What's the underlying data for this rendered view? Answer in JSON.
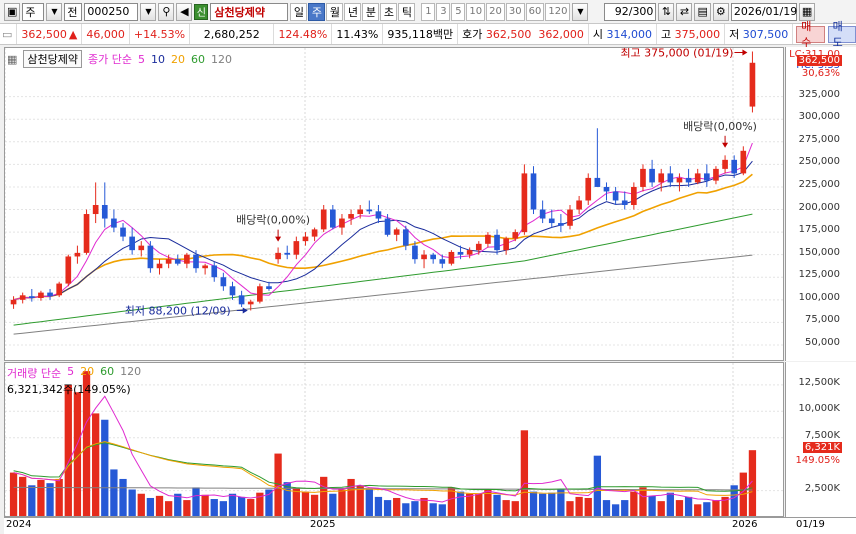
{
  "toolbar": {
    "market": "주",
    "type": "전",
    "code": "000250",
    "stock_name": "삼천당제약",
    "credit_badge": "신",
    "periods": [
      "일",
      "주",
      "월",
      "년",
      "분",
      "초",
      "틱"
    ],
    "active_period": "주",
    "ticks": [
      "1",
      "3",
      "5",
      "10",
      "20",
      "30",
      "60",
      "120"
    ],
    "count": "92/300",
    "date": "2026/01/19"
  },
  "quote": {
    "price": "362,500",
    "up_arrow": "▲",
    "change": "46,000",
    "change_pct": "+14.53%",
    "volume": "2,680,252",
    "vol_ratio": "124.48%",
    "turnover": "11.43%",
    "amount": "935,118백만",
    "ask_label": "호가",
    "ask1": "362,500",
    "ask2": "362,000",
    "open_label": "시",
    "open": "314,000",
    "high_label": "고",
    "high": "375,000",
    "low_label": "저",
    "low": "307,500",
    "buy_label": "매수",
    "sell_label": "매도"
  },
  "price_panel": {
    "tab": "삼천당제약",
    "ma_title": "종가 단순",
    "ma_periods": [
      "5",
      "10",
      "20",
      "60",
      "120"
    ],
    "annotations": {
      "high": "최고 375,000 (01/19)",
      "low": "최저 88,200 (12/09)",
      "dividend1": "배당락(0,00%)",
      "dividend2": "배당락(0,00%)"
    },
    "axis_top": "LC:311.00",
    "axis_top2": "HC:-3.33",
    "current_tag": "362,500",
    "current_pct": "30,63%",
    "y_ticks": [
      "325,000",
      "300,000",
      "275,000",
      "250,000",
      "225,000",
      "200,000",
      "175,000",
      "150,000",
      "125,000",
      "100,000",
      "75,000",
      "50,000"
    ]
  },
  "volume_panel": {
    "title": "거래량 단순",
    "ma_periods": [
      "5",
      "20",
      "60",
      "120"
    ],
    "current": "6,321,342주(149.05%)",
    "current_tag": "6,321K",
    "current_pct": "149.05%",
    "y_ticks": [
      "12,500K",
      "10,000K",
      "7,500K",
      "2,500K"
    ]
  },
  "date_axis": {
    "labels": [
      "2024",
      "2025",
      "2026"
    ],
    "cursor_date": "01/19"
  },
  "colors": {
    "up": "#e52b1c",
    "down": "#2659d6",
    "ma5": "#e02ad0",
    "ma10": "#1a2c9c",
    "ma20": "#f0a100",
    "ma60": "#2e9b2e",
    "ma120": "#808080"
  },
  "chart_data": {
    "type": "candlestick",
    "price_range": [
      40000,
      370000
    ],
    "candles": [
      [
        95000,
        104000,
        90000,
        100000
      ],
      [
        100000,
        108000,
        96000,
        105000
      ],
      [
        104000,
        112000,
        98000,
        102000
      ],
      [
        102000,
        110000,
        99000,
        108000
      ],
      [
        108000,
        112000,
        100000,
        104000
      ],
      [
        105000,
        120000,
        103000,
        118000
      ],
      [
        118000,
        150000,
        115000,
        148000
      ],
      [
        148000,
        160000,
        140000,
        152000
      ],
      [
        152000,
        200000,
        150000,
        195000
      ],
      [
        195000,
        230000,
        185000,
        205000
      ],
      [
        205000,
        230000,
        180000,
        190000
      ],
      [
        190000,
        200000,
        175000,
        180000
      ],
      [
        180000,
        185000,
        165000,
        170000
      ],
      [
        170000,
        180000,
        150000,
        155000
      ],
      [
        155000,
        165000,
        148000,
        160000
      ],
      [
        160000,
        165000,
        130000,
        135000
      ],
      [
        135000,
        145000,
        128000,
        140000
      ],
      [
        140000,
        150000,
        135000,
        145000
      ],
      [
        145000,
        150000,
        138000,
        140000
      ],
      [
        140000,
        152000,
        135000,
        150000
      ],
      [
        150000,
        155000,
        130000,
        135000
      ],
      [
        135000,
        140000,
        128000,
        138000
      ],
      [
        138000,
        142000,
        120000,
        125000
      ],
      [
        125000,
        130000,
        110000,
        115000
      ],
      [
        115000,
        120000,
        100000,
        105000
      ],
      [
        105000,
        110000,
        92000,
        95000
      ],
      [
        95000,
        100000,
        88200,
        98000
      ],
      [
        98000,
        118000,
        96000,
        115000
      ],
      [
        115000,
        120000,
        110000,
        112000
      ],
      [
        145000,
        158000,
        140000,
        152000
      ],
      [
        152000,
        160000,
        145000,
        150000
      ],
      [
        150000,
        170000,
        145000,
        165000
      ],
      [
        165000,
        175000,
        160000,
        170000
      ],
      [
        170000,
        180000,
        165000,
        178000
      ],
      [
        178000,
        205000,
        175000,
        200000
      ],
      [
        200000,
        205000,
        178000,
        180000
      ],
      [
        180000,
        195000,
        172000,
        190000
      ],
      [
        190000,
        200000,
        183000,
        195000
      ],
      [
        195000,
        205000,
        190000,
        200000
      ],
      [
        200000,
        210000,
        195000,
        198000
      ],
      [
        198000,
        205000,
        185000,
        190000
      ],
      [
        190000,
        195000,
        170000,
        172000
      ],
      [
        172000,
        180000,
        165000,
        178000
      ],
      [
        178000,
        182000,
        155000,
        160000
      ],
      [
        160000,
        165000,
        140000,
        145000
      ],
      [
        145000,
        155000,
        135000,
        150000
      ],
      [
        150000,
        152000,
        140000,
        145000
      ],
      [
        145000,
        150000,
        135000,
        140000
      ],
      [
        140000,
        155000,
        138000,
        153000
      ],
      [
        153000,
        160000,
        145000,
        150000
      ],
      [
        150000,
        158000,
        146000,
        155000
      ],
      [
        155000,
        165000,
        150000,
        162000
      ],
      [
        162000,
        175000,
        158000,
        172000
      ],
      [
        172000,
        178000,
        150000,
        155000
      ],
      [
        155000,
        170000,
        150000,
        168000
      ],
      [
        168000,
        178000,
        165000,
        175000
      ],
      [
        175000,
        250000,
        172000,
        240000
      ],
      [
        240000,
        248000,
        195000,
        200000
      ],
      [
        200000,
        210000,
        185000,
        190000
      ],
      [
        190000,
        200000,
        180000,
        185000
      ],
      [
        185000,
        195000,
        175000,
        182000
      ],
      [
        182000,
        205000,
        178000,
        200000
      ],
      [
        200000,
        215000,
        195000,
        210000
      ],
      [
        210000,
        240000,
        205000,
        235000
      ],
      [
        235000,
        290000,
        225000,
        225000
      ],
      [
        225000,
        230000,
        210000,
        220000
      ],
      [
        220000,
        225000,
        205000,
        210000
      ],
      [
        210000,
        220000,
        200000,
        205000
      ],
      [
        205000,
        230000,
        200000,
        225000
      ],
      [
        225000,
        250000,
        220000,
        245000
      ],
      [
        245000,
        255000,
        225000,
        230000
      ],
      [
        230000,
        245000,
        220000,
        240000
      ],
      [
        240000,
        248000,
        225000,
        230000
      ],
      [
        230000,
        240000,
        220000,
        235000
      ],
      [
        235000,
        245000,
        225000,
        230000
      ],
      [
        230000,
        245000,
        228000,
        240000
      ],
      [
        240000,
        250000,
        225000,
        232000
      ],
      [
        232000,
        248000,
        228000,
        245000
      ],
      [
        245000,
        260000,
        240000,
        255000
      ],
      [
        255000,
        260000,
        235000,
        240000
      ],
      [
        240000,
        270000,
        238000,
        265000
      ],
      [
        314000,
        375000,
        307500,
        362500
      ]
    ],
    "volume_range": [
      0,
      14000000
    ],
    "volumes": [
      4200000,
      3800000,
      3000000,
      3500000,
      3200000,
      3600000,
      12500000,
      11800000,
      13800000,
      9800000,
      9200000,
      4500000,
      3600000,
      2600000,
      2200000,
      1800000,
      2000000,
      1500000,
      2200000,
      1600000,
      2800000,
      2100000,
      1700000,
      1500000,
      2200000,
      1900000,
      1700000,
      2300000,
      2600000,
      6000000,
      3300000,
      2700000,
      2400000,
      2100000,
      3800000,
      2200000,
      2600000,
      3600000,
      2900000,
      2600000,
      1900000,
      1600000,
      1800000,
      1300000,
      1500000,
      1800000,
      1300000,
      1200000,
      2800000,
      2400000,
      2200000,
      2200000,
      2600000,
      2100000,
      1600000,
      1500000,
      8200000,
      2400000,
      2200000,
      2300000,
      2600000,
      1500000,
      1900000,
      1800000,
      5800000,
      1600000,
      1200000,
      1600000,
      2400000,
      2800000,
      2000000,
      1500000,
      2300000,
      1600000,
      1900000,
      1200000,
      1400000,
      1600000,
      1900000,
      3000000,
      4200000,
      6321342
    ]
  }
}
